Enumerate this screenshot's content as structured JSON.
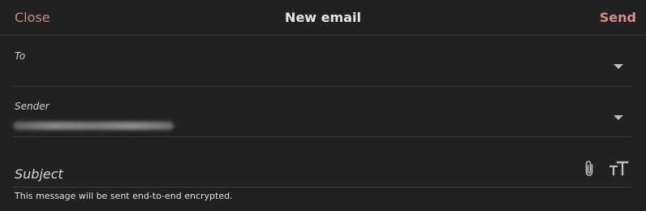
{
  "header": {
    "close_label": "Close",
    "title": "New email",
    "send_label": "Send"
  },
  "fields": {
    "to_label": "To",
    "sender_label": "Sender",
    "subject_placeholder": "Subject"
  },
  "footer": {
    "note": "This message will be sent end-to-end encrypted."
  },
  "icons": {
    "attach": "paperclip-icon",
    "text_format": "text-format-icon",
    "dropdown": "chevron-down-icon"
  },
  "colors": {
    "background": "#212121",
    "accent": "#d68e8e",
    "divider": "#3a3a3a"
  }
}
